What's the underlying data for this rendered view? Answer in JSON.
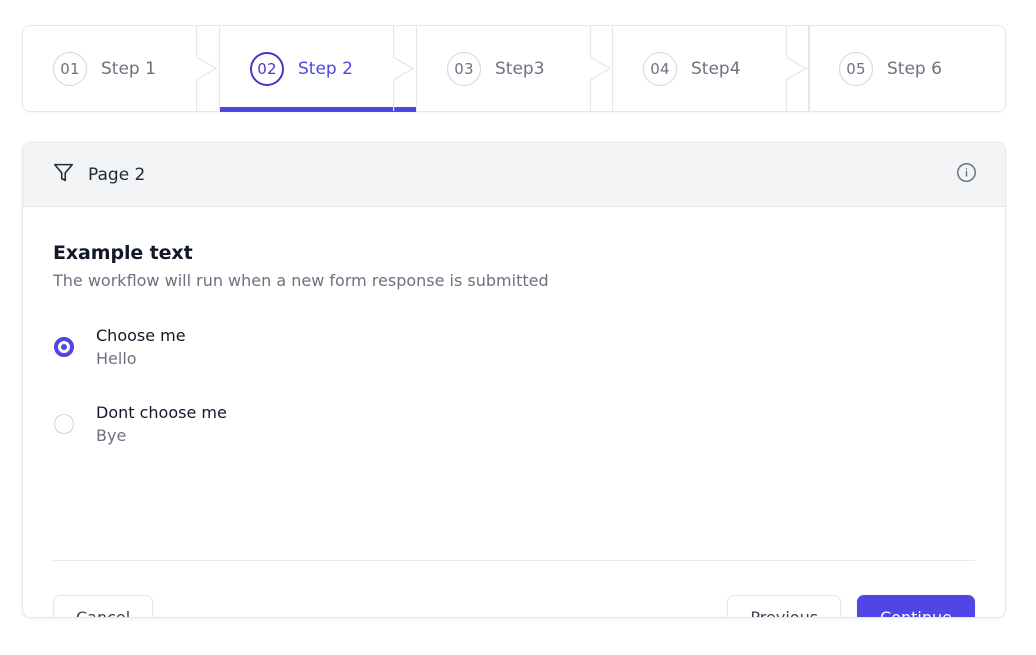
{
  "colors": {
    "accent": "#4f46e5",
    "accent_dark": "#4338ca",
    "border": "#e5e7eb",
    "header_bg": "#f3f4f6",
    "text_primary": "#111827",
    "text_muted": "#6b7280"
  },
  "stepper": {
    "steps": [
      {
        "number": "01",
        "label": "Step 1",
        "active": false
      },
      {
        "number": "02",
        "label": "Step 2",
        "active": true
      },
      {
        "number": "03",
        "label": "Step3",
        "active": false
      },
      {
        "number": "04",
        "label": "Step4",
        "active": false
      },
      {
        "number": "05",
        "label": "Step 6",
        "active": false
      }
    ]
  },
  "panel": {
    "header": {
      "icon": "filter-icon",
      "title": "Page 2",
      "info_icon": "info-icon"
    },
    "content": {
      "title": "Example text",
      "subtitle": "The workflow will run when a new form response is submitted",
      "options": [
        {
          "label": "Choose me",
          "description": "Hello",
          "selected": true
        },
        {
          "label": "Dont choose me",
          "description": "Bye",
          "selected": false
        }
      ]
    },
    "footer": {
      "cancel_label": "Cancel",
      "previous_label": "Previous",
      "continue_label": "Continue"
    }
  }
}
